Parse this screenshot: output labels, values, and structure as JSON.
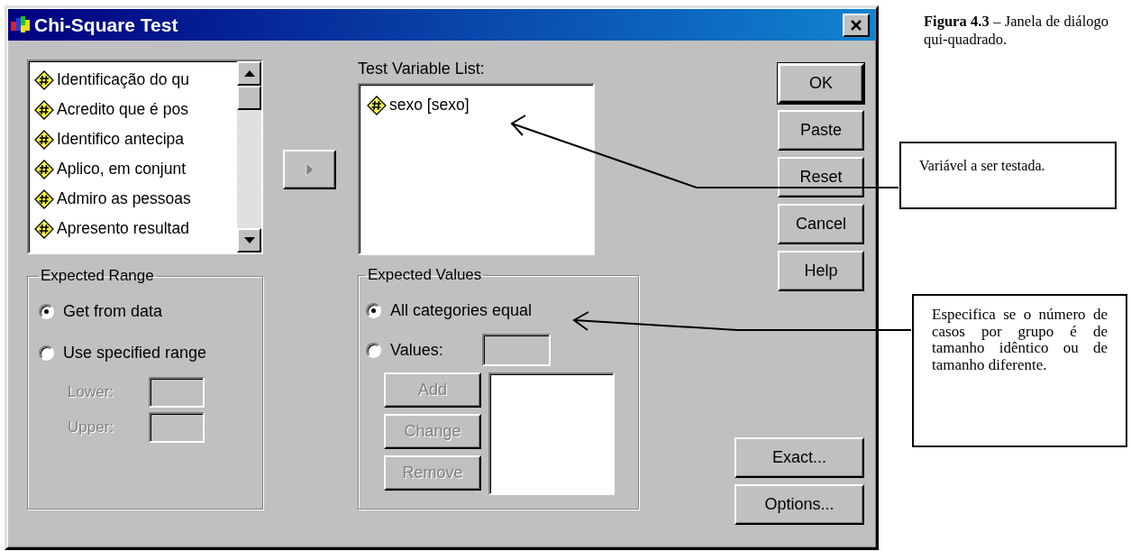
{
  "window": {
    "title": "Chi-Square Test"
  },
  "source_list": {
    "items": [
      "Identificação do qu",
      "Acredito que é pos",
      "Identifico antecipa",
      "Aplico, em conjunt",
      "Admiro as pessoas",
      "Apresento resultad"
    ]
  },
  "move_button": {
    "disabled": true
  },
  "test_list": {
    "label": "Test Variable List:",
    "items": [
      "sexo [sexo]"
    ]
  },
  "expected_range": {
    "title": "Expected Range",
    "options": [
      {
        "label": "Get from data",
        "selected": true
      },
      {
        "label": "Use specified range",
        "selected": false
      }
    ],
    "fields": [
      {
        "label": "Lower:",
        "disabled": true
      },
      {
        "label": "Upper:",
        "disabled": true
      }
    ]
  },
  "expected_values": {
    "title": "Expected Values",
    "options": [
      {
        "label": "All categories equal",
        "selected": true
      },
      {
        "label": "Values:",
        "selected": false
      }
    ],
    "buttons": [
      {
        "label": "Add",
        "disabled": true
      },
      {
        "label": "Change",
        "disabled": true
      },
      {
        "label": "Remove",
        "disabled": true
      }
    ]
  },
  "buttons": [
    {
      "label": "OK",
      "default": true
    },
    {
      "label": "Paste",
      "default": false
    },
    {
      "label": "Reset",
      "default": false
    },
    {
      "label": "Cancel",
      "default": false
    },
    {
      "label": "Help",
      "default": false
    }
  ],
  "more_buttons": [
    "Exact...",
    "Options..."
  ],
  "caption": "**Figura 4.3** – Janela de diálogo qui-quadrado.",
  "annotations": [
    "Variável a ser testada.",
    "Especifica se o número de casos por grupo é de tamanho idêntico ou de tamanho diferente."
  ]
}
